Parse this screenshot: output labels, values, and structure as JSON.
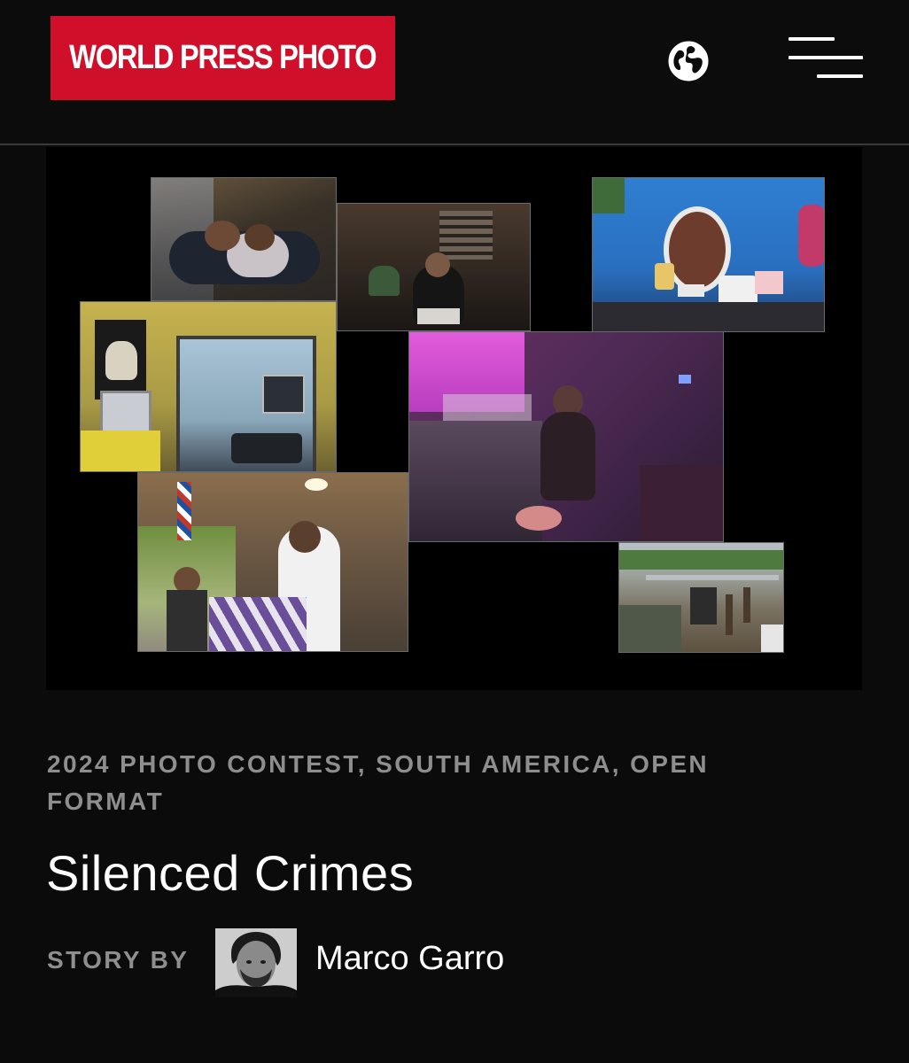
{
  "header": {
    "logo_text": "WORLD PRESS PHOTO",
    "logo_color": "#d0102a",
    "language_icon": "globe-icon",
    "menu_icon": "hamburger-menu-icon"
  },
  "story": {
    "category": "2024 PHOTO CONTEST, SOUTH AMERICA, OPEN FORMAT",
    "title": "Silenced Crimes",
    "byline_label": "STORY BY",
    "author": "Marco Garro"
  },
  "collage": {
    "photos": [
      "couple-resting-photo",
      "seated-man-photo",
      "vanity-mirror-photo",
      "living-room-photo",
      "pink-room-portrait-photo",
      "barbershop-photo",
      "cemetery-photo"
    ]
  }
}
